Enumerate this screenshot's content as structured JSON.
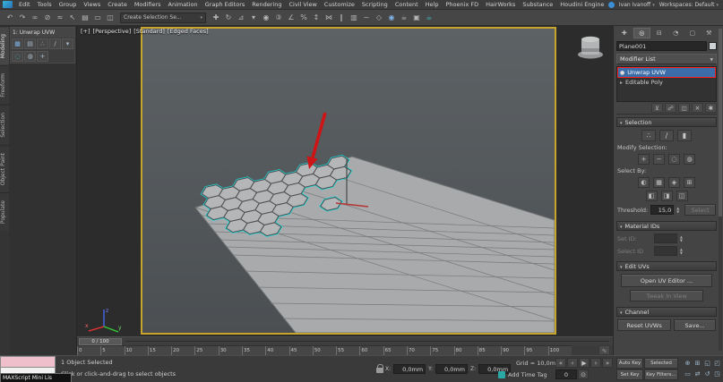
{
  "colors": {
    "accent_cyan": "#19dede",
    "annotation_red": "#ce1414",
    "safe_frame_yellow": "#c7a42c",
    "selection_blue": "#3d6da8"
  },
  "menu_bar": {
    "items": [
      "Edit",
      "Tools",
      "Group",
      "Views",
      "Create",
      "Modifiers",
      "Animation",
      "Graph Editors",
      "Rendering",
      "Civil View",
      "Customize",
      "Scripting",
      "Content",
      "Help",
      "Phoenix FD",
      "HairWorks",
      "Substance",
      "Houdini Engine"
    ],
    "user_name": "Ivan Ivanoff",
    "workspaces_label": "Workspaces: Default"
  },
  "toolbar": {
    "selection_set_value": "Create Selection Se...",
    "icons_left": [
      {
        "name": "undo-icon",
        "glyph": "↶"
      },
      {
        "name": "redo-icon",
        "glyph": "↷"
      },
      {
        "name": "select-and-link-icon",
        "glyph": "∞"
      },
      {
        "name": "unlink-selection-icon",
        "glyph": "⊘"
      },
      {
        "name": "bind-to-spacewarp-icon",
        "glyph": "≈"
      },
      {
        "name": "select-object-icon",
        "glyph": "↖"
      },
      {
        "name": "select-by-name-icon",
        "glyph": "▤"
      },
      {
        "name": "rectangular-selection-region-icon",
        "glyph": "▭"
      },
      {
        "name": "window-crossing-icon",
        "glyph": "◫"
      }
    ],
    "icons_right": [
      {
        "name": "select-and-move-icon",
        "glyph": "✚"
      },
      {
        "name": "select-and-rotate-icon",
        "glyph": "↻"
      },
      {
        "name": "select-and-scale-icon",
        "glyph": "⊿"
      },
      {
        "name": "reference-coordinate-dropdown-icon",
        "glyph": "▾"
      },
      {
        "name": "use-pivot-point-icon",
        "glyph": "◉"
      },
      {
        "name": "snaps-toggle-icon",
        "glyph": "③"
      },
      {
        "name": "angle-snap-icon",
        "glyph": "∠"
      },
      {
        "name": "percent-snap-icon",
        "glyph": "%"
      },
      {
        "name": "spinner-snap-icon",
        "glyph": "↕"
      },
      {
        "name": "mirror-icon",
        "glyph": "⋈"
      },
      {
        "name": "align-icon",
        "glyph": "∥"
      },
      {
        "name": "layer-explorer-icon",
        "glyph": "▥"
      },
      {
        "name": "curve-editor-icon",
        "glyph": "~"
      },
      {
        "name": "schematic-view-icon",
        "glyph": "◇"
      },
      {
        "name": "material-editor-icon",
        "glyph": "◉",
        "color": "#7fb2e5"
      },
      {
        "name": "render-setup-icon",
        "glyph": "☕",
        "color": "#b8b8b8"
      },
      {
        "name": "rendered-frame-window-icon",
        "glyph": "▣"
      },
      {
        "name": "render-production-icon",
        "glyph": "☕",
        "color": "#45b8b8"
      }
    ]
  },
  "ribbon_tabs": [
    {
      "name": "ribbon-tab-modeling",
      "label": "Modeling",
      "active": true
    },
    {
      "name": "ribbon-tab-freeform",
      "label": "Freeform"
    },
    {
      "name": "ribbon-tab-selection",
      "label": "Selection"
    },
    {
      "name": "ribbon-tab-object-paint",
      "label": "Object Paint"
    },
    {
      "name": "ribbon-tab-populate",
      "label": "Populate"
    }
  ],
  "quick_panel": {
    "title": "1: Unwrap UVW",
    "icons_row1": [
      {
        "name": "qp-modeling-icon",
        "glyph": "▦",
        "color": "#7fb2e5"
      },
      {
        "name": "qp-edit-icon",
        "glyph": "▤"
      },
      {
        "name": "qp-vertex-icon",
        "glyph": "∴"
      },
      {
        "name": "qp-edge-icon",
        "glyph": "∕"
      },
      {
        "name": "qp-dropdown-icon",
        "glyph": "▾"
      }
    ],
    "icons_row2": [
      {
        "name": "qp-loop-icon",
        "glyph": "◌",
        "color": "#58c0c0"
      },
      {
        "name": "qp-ring-icon",
        "glyph": "◍"
      },
      {
        "name": "qp-grow-icon",
        "glyph": "+"
      }
    ]
  },
  "viewport": {
    "labels": {
      "plus": "[+]",
      "view": "[Perspective]",
      "style": "[Standard]",
      "shading": "[Edged Faces]"
    },
    "axis": {
      "x": "x",
      "y": "y",
      "z": "z"
    }
  },
  "command_panel": {
    "tabs": [
      {
        "name": "tab-create-icon",
        "glyph": "✚"
      },
      {
        "name": "tab-modify-icon",
        "glyph": "◎",
        "active": true
      },
      {
        "name": "tab-hierarchy-icon",
        "glyph": "⊟"
      },
      {
        "name": "tab-motion-icon",
        "glyph": "◔"
      },
      {
        "name": "tab-display-icon",
        "glyph": "▢"
      },
      {
        "name": "tab-utilities-icon",
        "glyph": "⚒"
      }
    ],
    "object_name": "Plane001",
    "modifier_list_label": "Modifier List",
    "stack": [
      {
        "label": "Unwrap UVW"
      },
      {
        "label": "Editable Poly"
      }
    ],
    "stack_tools": [
      {
        "name": "pin-stack-icon",
        "glyph": "⊻"
      },
      {
        "name": "show-end-result-icon",
        "glyph": "☍"
      },
      {
        "name": "make-unique-icon",
        "glyph": "◫"
      },
      {
        "name": "remove-modifier-icon",
        "glyph": "✕"
      },
      {
        "name": "configure-modifier-sets-icon",
        "glyph": "✱"
      }
    ],
    "selection_rollout": {
      "title": "Selection",
      "subobject_icons": [
        {
          "name": "vertex-subobject-icon",
          "glyph": "∴"
        },
        {
          "name": "edge-subobject-icon",
          "glyph": "∕"
        },
        {
          "name": "polygon-subobject-icon",
          "glyph": "▮"
        }
      ],
      "modify_selection_label": "Modify Selection:",
      "modify_icons": [
        {
          "name": "grow-selection-icon",
          "glyph": "+"
        },
        {
          "name": "shrink-selection-icon",
          "glyph": "−"
        },
        {
          "name": "ring-selection-icon",
          "glyph": "◌"
        },
        {
          "name": "loop-selection-icon",
          "glyph": "◍"
        }
      ],
      "select_by_label": "Select By:",
      "select_by_icons_row1": [
        {
          "name": "ignore-backfacing-icon",
          "glyph": "◐"
        },
        {
          "name": "select-by-element-icon",
          "glyph": "▦"
        },
        {
          "name": "planar-angle-icon",
          "glyph": "◈"
        },
        {
          "name": "select-by-matid-icon",
          "glyph": "⊞"
        }
      ],
      "select_by_icons_row2": [
        {
          "name": "select-by-smoothing-group-icon",
          "glyph": "◧"
        },
        {
          "name": "select-by-color-icon",
          "glyph": "◨"
        },
        {
          "name": "invert-selection-icon",
          "glyph": "◫"
        }
      ],
      "threshold_label": "Threshold:",
      "threshold_value": "15,0",
      "select_button_label": "Select"
    },
    "material_ids_rollout": {
      "title": "Material IDs",
      "set_id_label": "Set ID:",
      "select_id_label": "Select ID"
    },
    "edit_uvs_rollout": {
      "title": "Edit UVs",
      "open_button": "Open UV Editor ...",
      "tweak_button": "Tweak In View"
    },
    "channel_rollout": {
      "title": "Channel",
      "reset_button": "Reset UVWs",
      "save_button": "Save..."
    }
  },
  "timeline": {
    "slider_label": "0 / 100",
    "ticks": [
      "0",
      "5",
      "10",
      "15",
      "20",
      "25",
      "30",
      "35",
      "40",
      "45",
      "50",
      "55",
      "60",
      "65",
      "70",
      "75",
      "80",
      "85",
      "90",
      "95",
      "100"
    ],
    "mini_curve_icon": [
      {
        "name": "open-mini-curve-editor-icon",
        "glyph": "∿"
      }
    ]
  },
  "status_bar": {
    "listener_tooltip": "MAXScript Mini Lis",
    "selected_text": "1 Object Selected",
    "prompt_text": "Click or click-and-drag to select objects",
    "coord_x_label": "X:",
    "coord_y_label": "Y:",
    "coord_z_label": "Z:",
    "coord_x": "0,0mm",
    "coord_y": "0,0mm",
    "coord_z": "0,0mm",
    "grid_text": "Grid = 10,0mm",
    "add_time_tag": "Add Time Tag",
    "transport": [
      {
        "name": "go-to-start-button",
        "glyph": "«"
      },
      {
        "name": "previous-frame-button",
        "glyph": "‹"
      },
      {
        "name": "play-button",
        "glyph": "▶"
      },
      {
        "name": "next-frame-button",
        "glyph": "›"
      },
      {
        "name": "go-to-end-button",
        "glyph": "»"
      }
    ],
    "transport_row2": [
      {
        "name": "key-mode-toggle-icon",
        "glyph": "⊙"
      }
    ],
    "frame_value": "0",
    "auto_key": "Auto Key",
    "set_key": "Set Key",
    "selected_dropdown": "Selected",
    "key_filters": "Key Filters...",
    "nav_icons": [
      {
        "name": "zoom-icon",
        "glyph": "⊕"
      },
      {
        "name": "zoom-all-icon",
        "glyph": "⊞"
      },
      {
        "name": "zoom-extents-icon",
        "glyph": "◱"
      },
      {
        "name": "zoom-extents-all-icon",
        "glyph": "◰"
      },
      {
        "name": "field-of-view-icon",
        "glyph": "▭"
      },
      {
        "name": "pan-icon",
        "glyph": "⇄"
      },
      {
        "name": "orbit-icon",
        "glyph": "↺"
      },
      {
        "name": "maximize-viewport-toggle-icon",
        "glyph": "◳"
      }
    ]
  }
}
